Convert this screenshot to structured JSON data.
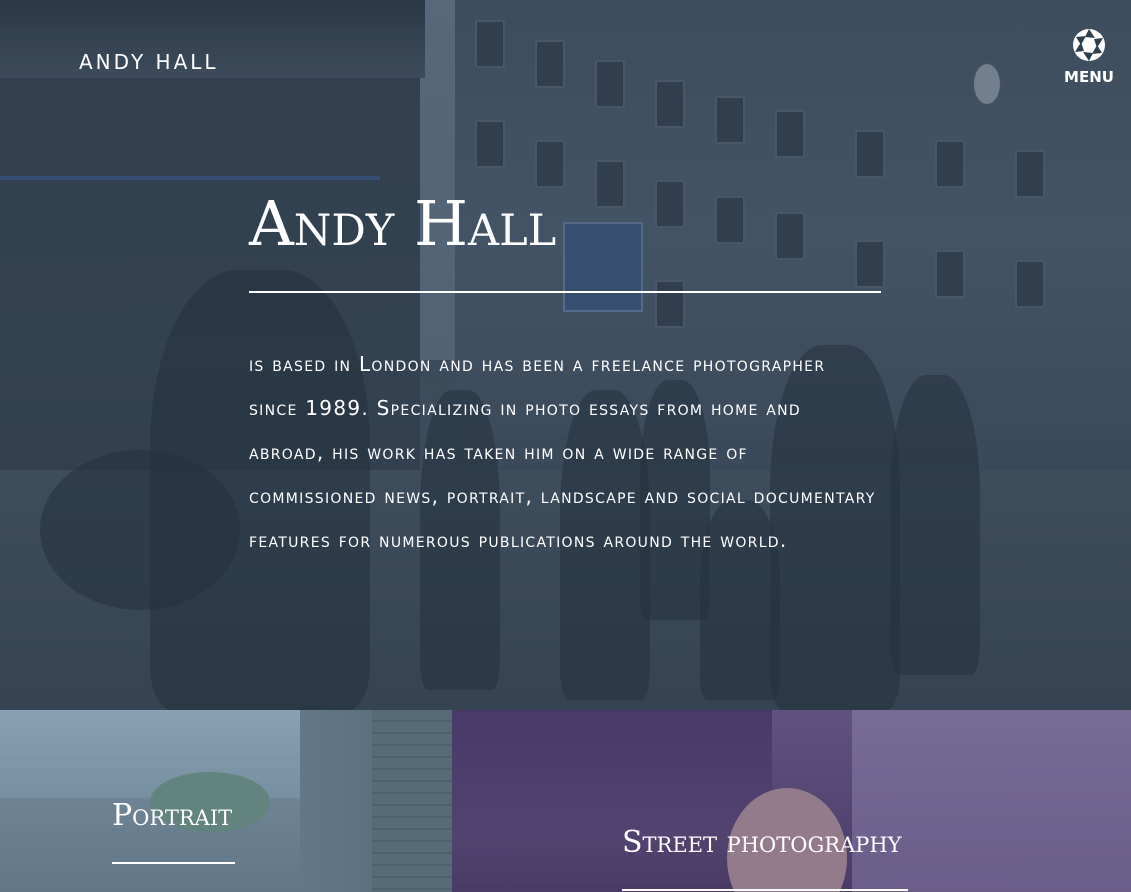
{
  "header": {
    "brand": "ANDY HALL",
    "menu_label": "MENU",
    "menu_icon": "aperture-icon"
  },
  "hero": {
    "title": "Andy Hall",
    "bio": "is based in London and has been a freelance photographer since 1989. Specializing in photo essays from home and abroad, his work has taken him on a wide range of commissioned news, portrait, landscape and social documentary features for numerous publications around the world."
  },
  "categories": [
    {
      "label": "Portrait"
    },
    {
      "label": "Street photography"
    }
  ]
}
